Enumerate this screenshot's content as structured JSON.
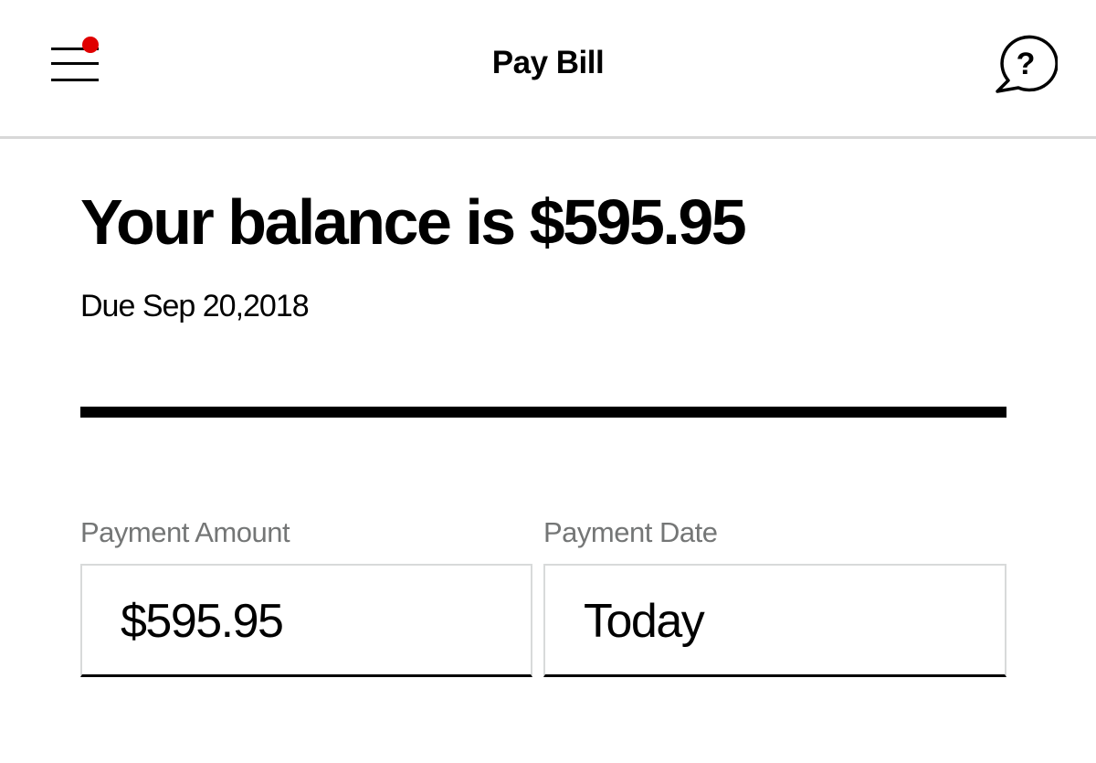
{
  "header": {
    "title": "Pay Bill",
    "menu_icon": "hamburger-menu-icon",
    "notification_color": "#e00000",
    "help_icon": "question-chat-bubble-icon"
  },
  "balance": {
    "heading": "Your balance is $595.95",
    "due_text": "Due Sep 20,2018"
  },
  "payment": {
    "amount_label": "Payment Amount",
    "amount_value": "$595.95",
    "date_label": "Payment Date",
    "date_value": "Today"
  },
  "colors": {
    "accent": "#e00000",
    "label_gray": "#747676",
    "border_gray": "#d8dada",
    "text": "#000000"
  }
}
